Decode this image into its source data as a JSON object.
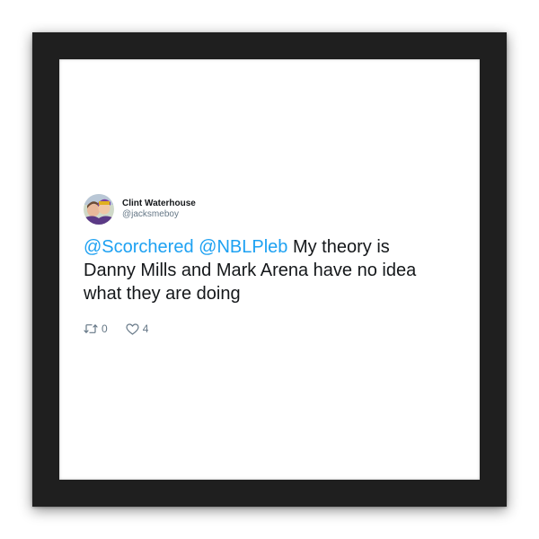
{
  "tweet": {
    "author": {
      "display_name": "Clint Waterhouse",
      "handle": "@jacksmeboy",
      "avatar_icon": "profile-photo-avatar"
    },
    "body": {
      "mention_1": "@Scorchered",
      "mention_2": "@NBLPleb",
      "text": "My theory is Danny Mills and Mark Arena have no idea what they are doing"
    },
    "actions": {
      "retweet_icon": "retweet-icon",
      "retweet_count": "0",
      "like_icon": "heart-icon",
      "like_count": "4"
    },
    "colors": {
      "mention": "#1da1f2",
      "text": "#14171a",
      "muted": "#657786",
      "frame": "#1f1f1f"
    }
  }
}
